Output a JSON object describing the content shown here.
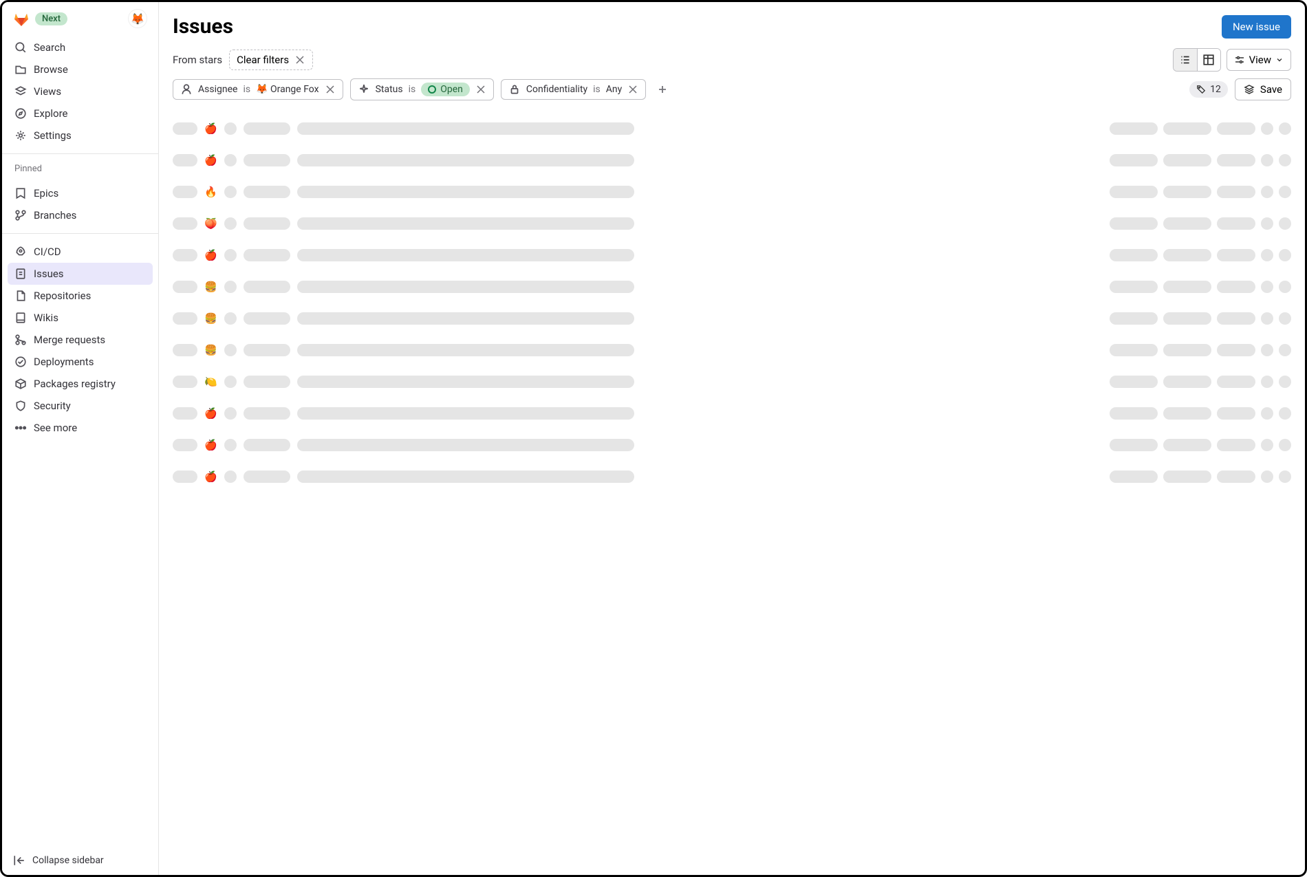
{
  "header": {
    "badge": "Next",
    "avatar_emoji": "🦊"
  },
  "sidebar": {
    "primary": [
      {
        "icon": "search",
        "label": "Search"
      },
      {
        "icon": "folder",
        "label": "Browse"
      },
      {
        "icon": "layers",
        "label": "Views"
      },
      {
        "icon": "compass",
        "label": "Explore"
      },
      {
        "icon": "gear",
        "label": "Settings"
      }
    ],
    "pinned_header": "Pinned",
    "pinned": [
      {
        "icon": "epic",
        "label": "Epics"
      },
      {
        "icon": "branch",
        "label": "Branches"
      }
    ],
    "items": [
      {
        "icon": "rocket",
        "label": "CI/CD"
      },
      {
        "icon": "issue",
        "label": "Issues",
        "active": true
      },
      {
        "icon": "file",
        "label": "Repositories"
      },
      {
        "icon": "book",
        "label": "Wikis"
      },
      {
        "icon": "merge",
        "label": "Merge requests"
      },
      {
        "icon": "deploy",
        "label": "Deployments"
      },
      {
        "icon": "package",
        "label": "Packages registry"
      },
      {
        "icon": "shield",
        "label": "Security"
      },
      {
        "icon": "dots",
        "label": "See more"
      }
    ],
    "collapse": "Collapse sidebar"
  },
  "main": {
    "title": "Issues",
    "new_button": "New issue",
    "from": "From stars",
    "clear": "Clear filters",
    "view_label": "View",
    "filters": [
      {
        "icon": "user",
        "field": "Assignee",
        "op": "is",
        "value": "Orange Fox",
        "emoji": "🦊"
      },
      {
        "icon": "sparkle",
        "field": "Status",
        "op": "is",
        "value": "Open",
        "pill": true
      },
      {
        "icon": "lock",
        "field": "Confidentiality",
        "op": "is",
        "value": "Any"
      }
    ],
    "count": "12",
    "save": "Save",
    "rows": [
      {
        "emoji": "🍎"
      },
      {
        "emoji": "🍎"
      },
      {
        "emoji": "🔥"
      },
      {
        "emoji": "🍑"
      },
      {
        "emoji": "🍎"
      },
      {
        "emoji": "🍔"
      },
      {
        "emoji": "🍔"
      },
      {
        "emoji": "🍔"
      },
      {
        "emoji": "🍋"
      },
      {
        "emoji": "🍎"
      },
      {
        "emoji": "🍎"
      },
      {
        "emoji": "🍎"
      }
    ]
  }
}
